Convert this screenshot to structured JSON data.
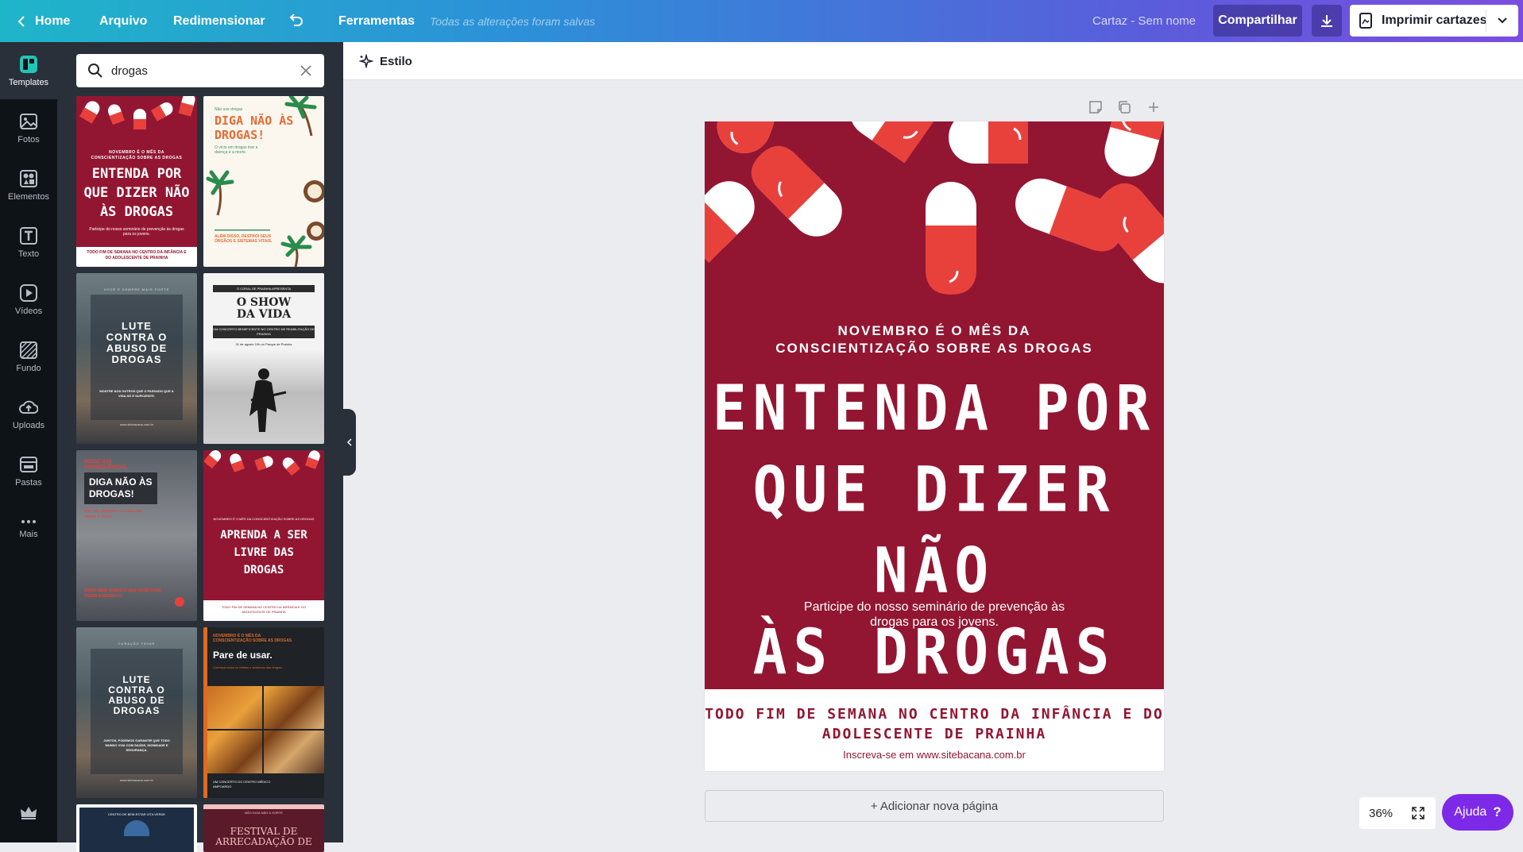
{
  "topbar": {
    "home": "Home",
    "file": "Arquivo",
    "resize": "Redimensionar",
    "tools": "Ferramentas",
    "saved_status": "Todas as alterações foram salvas",
    "doc_title": "Cartaz - Sem nome",
    "share": "Compartilhar",
    "print": "Imprimir cartazes"
  },
  "rail": {
    "items": [
      {
        "label": "Templates",
        "icon": "templates-icon"
      },
      {
        "label": "Fotos",
        "icon": "photos-icon"
      },
      {
        "label": "Elementos",
        "icon": "elements-icon"
      },
      {
        "label": "Texto",
        "icon": "text-icon"
      },
      {
        "label": "Vídeos",
        "icon": "video-icon"
      },
      {
        "label": "Fundo",
        "icon": "background-icon"
      },
      {
        "label": "Uploads",
        "icon": "upload-icon"
      },
      {
        "label": "Pastas",
        "icon": "folder-icon"
      },
      {
        "label": "Mais",
        "icon": "more-icon"
      }
    ]
  },
  "search": {
    "value": "drogas"
  },
  "templates": [
    {
      "lines": [
        "NOVEMBRO É O MÊS DA",
        "CONSCIENTIZAÇÃO SOBRE AS DROGAS"
      ],
      "title": [
        "ENTENDA POR",
        "QUE DIZER NÃO",
        "ÀS DROGAS"
      ],
      "body": "Participe do nosso seminário de prevenção às drogas para os jovens.",
      "foot": "TODO FIM DE SEMANA NO CENTRO DA INFÂNCIA E DO ADOLESCENTE DE PRAINHA"
    },
    {
      "lines": [
        "Não use drogas"
      ],
      "title": [
        "DIGA NÃO ÀS",
        "DROGAS!"
      ],
      "body": "O vício em drogas traz a doença e a morte.",
      "foot": "ALÉM DISSO, DESTRÓI SEUS ÓRGÃOS E SISTEMAS VITAIS."
    },
    {
      "lines": [
        "VOCÊ É SEMPRE MAIS FORTE"
      ],
      "title": [
        "LUTE",
        "CONTRA O",
        "ABUSO DE",
        "DROGAS"
      ],
      "body": "MOSTRE AOS OUTROS QUE O PASSADO QUE A VIDA SÓ É SUFICIENTE.",
      "foot": "www.sitebacana.com.br"
    },
    {
      "lines": [
        "O CORAL DE PRAINHA APRESENTA"
      ],
      "title": [
        "O SHOW",
        "DA VIDA"
      ],
      "body": "UM CONCERTO BENEFICENTE NO CENTRO DE REABILITAÇÃO DE PRAINHA",
      "foot": "31 de agosto 19h no Parque de Prainha"
    },
    {
      "lines": [
        "PENSE NAS",
        "CONSEQUÊNCIAS."
      ],
      "title": [
        "DIGA NÃO ÀS",
        "DROGAS!"
      ],
      "body": "Elas não oferecem só a sua vida, afetam a outros.",
      "foot": "SAIBA MAIS SOBRE O QUE VOCÊ PODE FAZER A RESPEITO."
    },
    {
      "lines": [
        "NOVEMBRO É O MÊS DA CONSCIENTIZAÇÃO SOBRE AS DROGAS"
      ],
      "title": [
        "APRENDA A SER",
        "LIVRE DAS",
        "DROGAS"
      ],
      "body": "",
      "foot": "TODO FIM DE SEMANA NO CENTRO DA INFÂNCIA E DO ADOLESCENTE DE PRAINHA"
    },
    {
      "lines": [
        "CURAÇÃO FAVAN"
      ],
      "title": [
        "LUTE",
        "CONTRA O",
        "ABUSO DE",
        "DROGAS"
      ],
      "body": "JUNTOS, PODEMOS GARANTIR QUE TODO MUNDO VIVA COM SAÚDE, DIGNIDADE E SEGURANÇA.",
      "foot": "www.sitebacana.com.br"
    },
    {
      "lines": [
        "NOVEMBRO É O MÊS DA",
        "CONSCIENTIZAÇÃO SOBRE AS DROGAS"
      ],
      "title": [
        "Pare de usar."
      ],
      "body": "Conheça todos os efeitos e sintomas das drogas.",
      "foot": "UM CONCERTO DO CENTRO MÉDICO AMPOARDO"
    },
    {
      "lines": [
        "CENTRO DE BEM-ESTAR VITA VERDE"
      ],
      "title": [],
      "body": "",
      "foot": ""
    },
    {
      "lines": [
        "NÃO DIGA NÃO À SORTE"
      ],
      "title": [
        "FESTIVAL DE",
        "ARRECADAÇÃO DE"
      ],
      "body": "",
      "foot": ""
    }
  ],
  "toolbar": {
    "style": "Estilo"
  },
  "poster": {
    "sub1": "NOVEMBRO É O MÊS DA",
    "sub2": "CONSCIENTIZAÇÃO SOBRE AS DROGAS",
    "title1": "ENTENDA POR",
    "title2": "QUE DIZER NÃO",
    "title3": "ÀS DROGAS",
    "desc1": "Participe do nosso seminário de prevenção às",
    "desc2": "drogas para os jovens.",
    "foot1": "TODO FIM DE SEMANA NO CENTRO DA INFÂNCIA E DO",
    "foot2": "ADOLESCENTE DE PRAINHA",
    "url": "Inscreva-se em www.sitebacana.com.br"
  },
  "add_page": "+ Adicionar nova página",
  "zoom": "36%",
  "help": "Ajuda",
  "help_mark": "?",
  "colors": {
    "accent": "#7d2ae8",
    "poster_red": "#921632",
    "pill_red": "#e8413c"
  }
}
